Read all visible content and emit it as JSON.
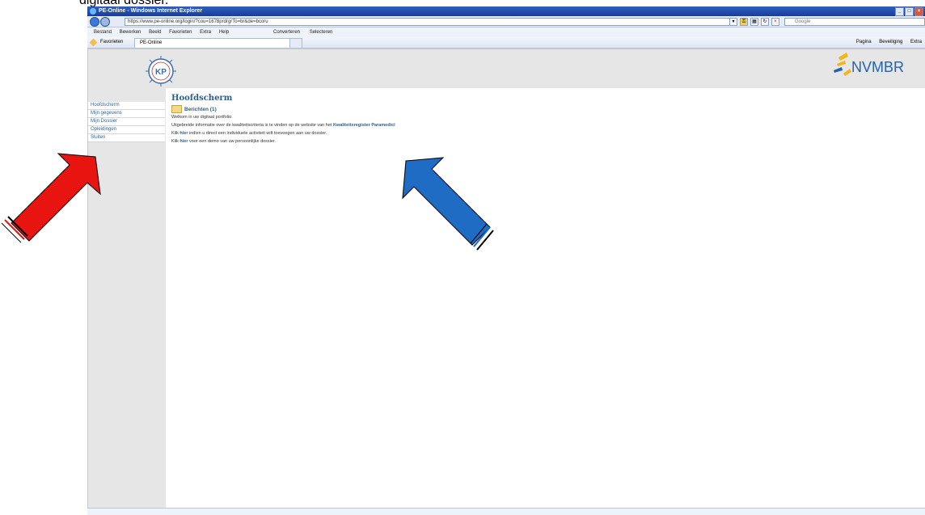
{
  "caption": "digitaal dossier.",
  "window": {
    "title": "PE-Online - Windows Internet Explorer",
    "url_prefix": "https",
    "url": "://www.pe-online.org/login/?cou=1678prdrgrTo=br&de=bcoru"
  },
  "browser_menu": [
    "Bestand",
    "Bewerken",
    "Beeld",
    "Favorieten",
    "Extra",
    "Help"
  ],
  "convert_menu": [
    "Converteren",
    "Selecteren"
  ],
  "search_placeholder": "Google",
  "favorites_label": "Favorieten",
  "tab_title": "PE-Online",
  "command_bar": [
    "Pagina",
    "Beveiliging",
    "Extra"
  ],
  "header": {
    "kp_logo_text": "KP",
    "nvmbr_logo_text": "NVMBR"
  },
  "sidebar": {
    "items": [
      {
        "label": "Hoofdscherm"
      },
      {
        "label": "Mijn gegevens"
      },
      {
        "label": "Mijn Dossier"
      },
      {
        "label": "Opleidingen"
      },
      {
        "label": "Sluiten"
      }
    ]
  },
  "main": {
    "title": "Hoofdscherm",
    "berichten": "Berichten (1)",
    "welcome": "Welkom in uw digitaal portfolio.",
    "info_prefix": "Uitgebreide informatie over de kwaliteitscriteria is te vinden op de website van het ",
    "info_link": "Kwaliteitsregister Paramedici",
    "line2_prefix": "Klik ",
    "line2_link": "hier",
    "line2_suffix": " indien u direct een individuele activiteit wilt toevoegen aan uw dossier.",
    "line3_prefix": "Klik ",
    "line3_link": "hier",
    "line3_suffix": " voor een demo van uw persoonlijke dossier."
  },
  "colors": {
    "red_arrow": "#e8140f",
    "blue_arrow": "#1f6cc4",
    "link": "#2b5f8e"
  }
}
